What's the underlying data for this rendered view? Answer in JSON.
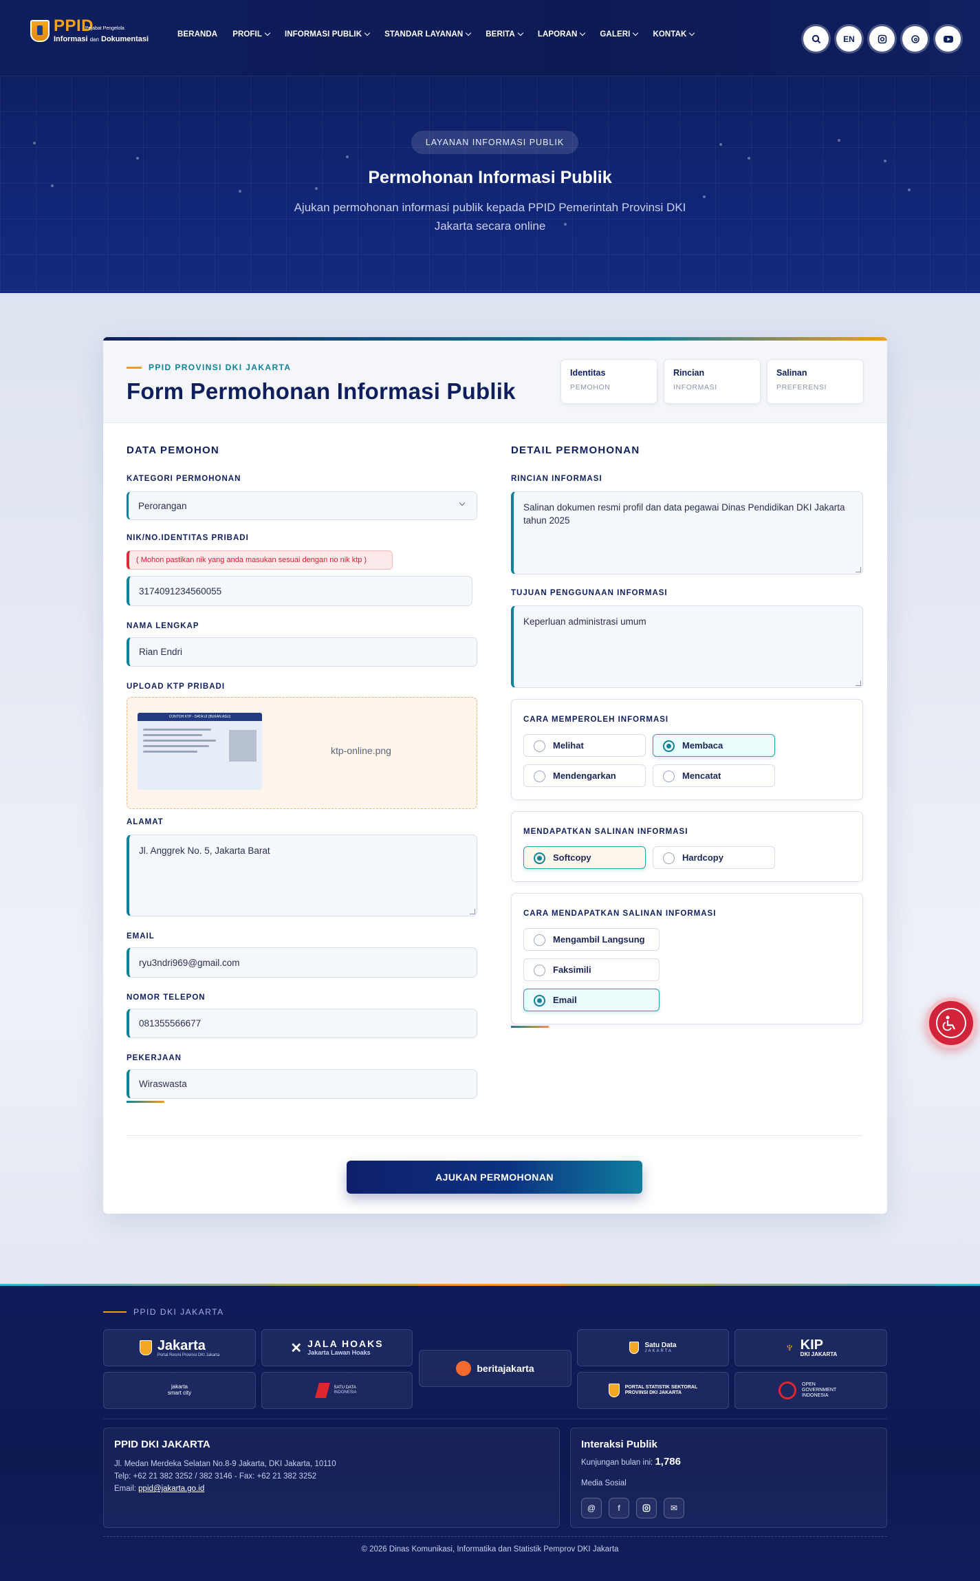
{
  "header": {
    "logo_ppid": "PPID",
    "logo_sub_a": "Informasi",
    "logo_sub_dan": "dan",
    "logo_sub_b": "Dokumentasi",
    "logo_tag": "Pejabat Pengelola",
    "nav": [
      {
        "label": "BERANDA",
        "dropdown": false
      },
      {
        "label": "PROFIL",
        "dropdown": true
      },
      {
        "label": "INFORMASI PUBLIK",
        "dropdown": true
      },
      {
        "label": "STANDAR LAYANAN",
        "dropdown": true
      },
      {
        "label": "BERITA",
        "dropdown": true
      },
      {
        "label": "LAPORAN",
        "dropdown": true
      },
      {
        "label": "GALERI",
        "dropdown": true
      },
      {
        "label": "KONTAK",
        "dropdown": true
      }
    ],
    "icons": {
      "search": "search-icon",
      "lang": "EN",
      "instagram": "instagram-icon",
      "threads": "threads-icon",
      "youtube": "youtube-icon"
    }
  },
  "hero": {
    "badge": "LAYANAN INFORMASI PUBLIK",
    "title": "Permohonan Informasi Publik",
    "description": "Ajukan permohonan informasi publik kepada PPID Pemerintah Provinsi DKI Jakarta secara online"
  },
  "form": {
    "eyebrow": "PPID PROVINSI DKI JAKARTA",
    "title": "Form Permohonan Informasi Publik",
    "steps": [
      {
        "title": "Identitas",
        "sub": "PEMOHON"
      },
      {
        "title": "Rincian",
        "sub": "INFORMASI"
      },
      {
        "title": "Salinan",
        "sub": "PREFERENSI"
      }
    ],
    "left": {
      "section_title": "DATA PEMOHON",
      "kategori_label": "KATEGORI PERMOHONAN",
      "kategori_value": "Perorangan",
      "nik_label": "NIK/NO.IDENTITAS PRIBADI",
      "nik_warning": "( Mohon pastikan nik yang anda masukan sesuai dengan no nik ktp )",
      "nik_value": "3174091234560055",
      "nama_label": "NAMA LENGKAP",
      "nama_value": "Rian Endri",
      "upload_label": "UPLOAD KTP PRIBADI",
      "upload_filename": "ktp-online.png",
      "ktp_preview_title": "CONTOH KTP - DATA UI (BUKAN ASLI)",
      "alamat_label": "ALAMAT",
      "alamat_value": "Jl. Anggrek No. 5, Jakarta Barat",
      "email_label": "EMAIL",
      "email_value": "ryu3ndri969@gmail.com",
      "telepon_label": "NOMOR TELEPON",
      "telepon_value": "081355566677",
      "pekerjaan_label": "PEKERJAAN",
      "pekerjaan_value": "Wiraswasta"
    },
    "right": {
      "section_title": "DETAIL PERMOHONAN",
      "rincian_label": "RINCIAN INFORMASI",
      "rincian_value": "Salinan dokumen resmi profil dan data pegawai Dinas Pendidikan DKI Jakarta tahun 2025",
      "tujuan_label": "TUJUAN PENGGUNAAN INFORMASI",
      "tujuan_value": "Keperluan administrasi umum",
      "cara_memperoleh": {
        "title": "CARA MEMPEROLEH INFORMASI",
        "options": [
          "Melihat",
          "Membaca",
          "Mendengarkan",
          "Mencatat"
        ],
        "selected": "Membaca"
      },
      "mendapatkan_salinan": {
        "title": "MENDAPATKAN SALINAN INFORMASI",
        "options": [
          "Softcopy",
          "Hardcopy"
        ],
        "selected": "Softcopy"
      },
      "cara_salinan": {
        "title": "CARA MENDAPATKAN SALINAN INFORMASI",
        "options": [
          "Mengambil Langsung",
          "Faksimili",
          "Email"
        ],
        "selected": "Email"
      }
    },
    "submit_label": "AJUKAN PERMOHONAN"
  },
  "footer": {
    "eyebrow": "PPID DKI JAKARTA",
    "logos": [
      {
        "name": "Jakarta",
        "sub": "Portal Resmi Provinsi DKI Jakarta"
      },
      {
        "name": "JALA HOAKS",
        "sub": "Jakarta Lawan Hoaks"
      },
      {
        "name": "beritajakarta",
        "sub": ""
      },
      {
        "name": "Satu Data",
        "sub": "JAKARTA"
      },
      {
        "name": "KIP",
        "sub": "DKI JAKARTA"
      },
      {
        "name": "jakarta smart city",
        "sub": ""
      },
      {
        "name": "SATU DATA",
        "sub": "INDONESIA"
      },
      {
        "name": "PORTAL STATISTIK SEKTORAL",
        "sub": "PROVINSI DKI JAKARTA"
      },
      {
        "name": "OPEN GOVERNMENT",
        "sub": "INDONESIA"
      }
    ],
    "contact": {
      "title": "PPID DKI JAKARTA",
      "address": "Jl. Medan Merdeka Selatan No.8-9 Jakarta, DKI Jakarta, 10110",
      "phone": "Telp: +62 21 382 3252 / 382 3146 - Fax: +62 21 382 3252",
      "email_prefix": "Email:",
      "email": "ppid@jakarta.go.id"
    },
    "interaksi": {
      "title": "Interaksi Publik",
      "visits_label": "Kunjungan bulan ini:",
      "visits_value": "1,786",
      "social_label": "Media Sosial",
      "social_icons": [
        "threads-icon",
        "facebook-icon",
        "instagram-icon",
        "mail-icon"
      ]
    },
    "copyright": "© 2026 Dinas Komunikasi, Informatika dan Statistik Pemprov DKI Jakarta"
  },
  "colors": {
    "navy": "#0f1f5e",
    "teal": "#0f8198",
    "orange": "#f49a21",
    "red": "#d1243a"
  }
}
